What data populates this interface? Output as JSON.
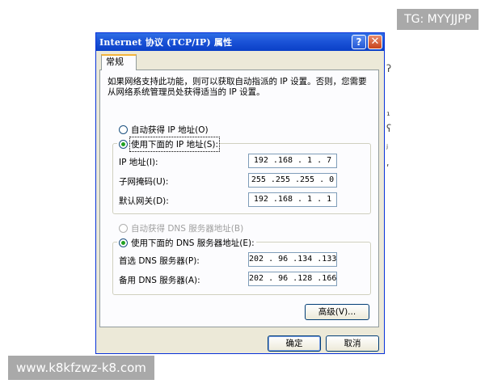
{
  "window": {
    "title": "Internet 协议 (TCP/IP) 属性",
    "help_glyph": "?",
    "close_glyph": "✕"
  },
  "tabs": [
    {
      "label": "常规",
      "selected": true
    }
  ],
  "description": "如果网络支持此功能，则可以获取自动指派的 IP 设置。否则，您需要从网络系统管理员处获得适当的 IP 设置。",
  "ip_section": {
    "auto_label": "自动获得 IP 地址(O)",
    "auto_checked": false,
    "manual_label": "使用下面的 IP 地址(S):",
    "manual_checked": true,
    "fields": [
      {
        "label": "IP 地址(I):",
        "value": "192 .168 . 1 . 7"
      },
      {
        "label": "子网掩码(U):",
        "value": "255 .255 .255 . 0"
      },
      {
        "label": "默认网关(D):",
        "value": "192 .168 . 1 . 1"
      }
    ]
  },
  "dns_section": {
    "auto_label": "自动获得 DNS 服务器地址(B)",
    "auto_checked": false,
    "auto_enabled": false,
    "manual_label": "使用下面的 DNS 服务器地址(E):",
    "manual_checked": true,
    "fields": [
      {
        "label": "首选 DNS 服务器(P):",
        "value": "202 . 96 .134 .133"
      },
      {
        "label": "备用 DNS 服务器(A):",
        "value": "202 . 96 .128 .166"
      }
    ]
  },
  "buttons": {
    "advanced": "高级(V)...",
    "ok": "确定",
    "cancel": "取消"
  },
  "edge_glyphs": [
    "ʔ",
    "¹",
    "ʕ",
    "ʲ",
    "ʹ"
  ],
  "watermarks": {
    "top_right": "TG: MYYJJPP",
    "bottom_left": "www.k8kfzwz-k8.com"
  },
  "colors": {
    "titlebar": "#0a3fc7",
    "dialog_bg": "#ece9d8",
    "panel_bg": "#fcfcfe",
    "radio_dot": "#21a121",
    "watermark_bg": "#a9a9a9"
  }
}
